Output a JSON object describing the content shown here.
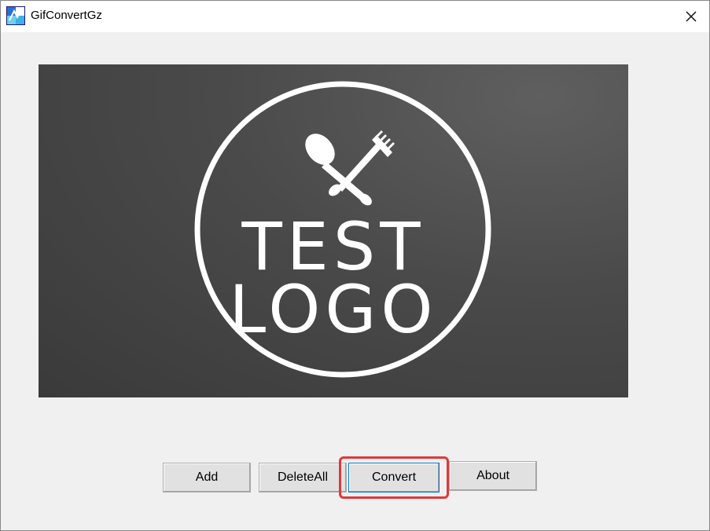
{
  "window": {
    "title": "GifConvertGz"
  },
  "preview": {
    "logo_line1": "TEST",
    "logo_line2": "LOGO"
  },
  "buttons": {
    "add": "Add",
    "delete_all": "DeleteAll",
    "convert": "Convert",
    "about": "About"
  },
  "icons": {
    "app": "gifconvert-app-icon",
    "close": "close-icon",
    "logo": "spoon-fork-icon"
  },
  "colors": {
    "highlight": "#e0383a",
    "focus": "#0078d7"
  }
}
